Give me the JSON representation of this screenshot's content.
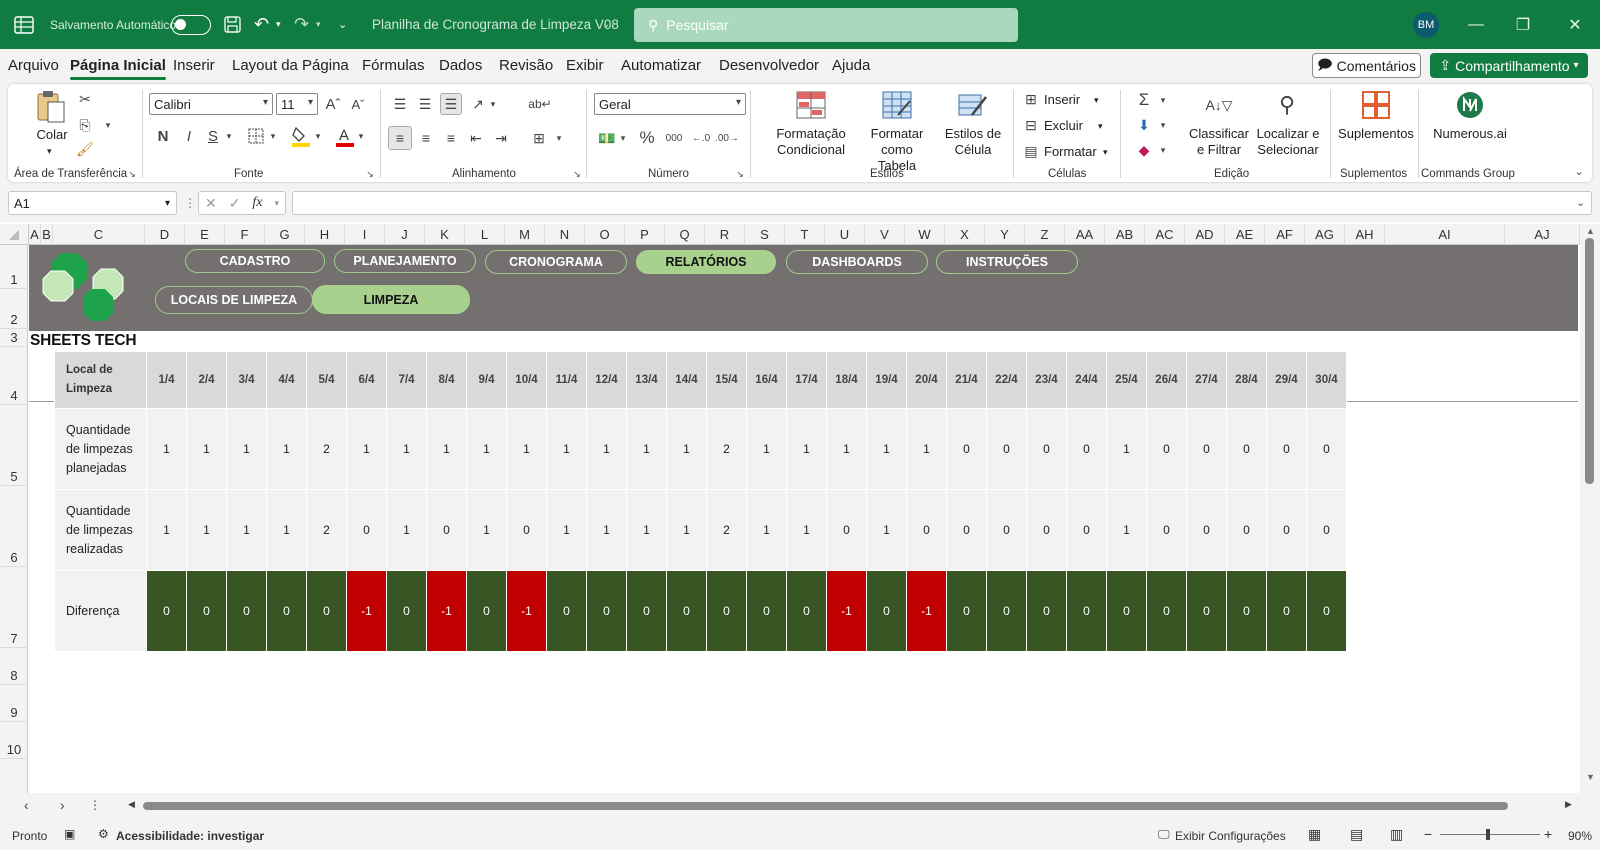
{
  "titlebar": {
    "autosave_label": "Salvamento Automático",
    "doc_title": "Planilha de Cronograma de Limpeza V08",
    "search_placeholder": "Pesquisar",
    "user_initials": "BM"
  },
  "menu": {
    "items": [
      "Arquivo",
      "Página Inicial",
      "Inserir",
      "Layout da Página",
      "Fórmulas",
      "Dados",
      "Revisão",
      "Exibir",
      "Automatizar",
      "Desenvolvedor",
      "Ajuda"
    ],
    "active": "Página Inicial",
    "comments": "Comentários",
    "share": "Compartilhamento"
  },
  "ribbon": {
    "clipboard": {
      "paste": "Colar",
      "group": "Área de Transferência"
    },
    "font": {
      "name": "Calibri",
      "size": "11",
      "group": "Fonte",
      "bold": "N",
      "italic": "I",
      "underline": "S",
      "grow": "A^",
      "shrink": "Aˇ"
    },
    "alignment": {
      "group": "Alinhamento"
    },
    "number": {
      "format": "Geral",
      "group": "Número",
      "percent": "%",
      "thousands": "000"
    },
    "styles": {
      "cond": "Formatação\nCondicional",
      "table": "Formatar como\nTabela",
      "cell": "Estilos de\nCélula",
      "group": "Estilos"
    },
    "cells": {
      "insert": "Inserir",
      "delete": "Excluir",
      "format": "Formatar",
      "group": "Células"
    },
    "editing": {
      "sort": "Classificar\ne Filtrar",
      "find": "Localizar e\nSelecionar",
      "group": "Edição"
    },
    "addins": {
      "label": "Suplementos",
      "group": "Suplementos"
    },
    "commands": {
      "label": "Numerous.ai",
      "group": "Commands Group"
    }
  },
  "formula": {
    "namebox": "A1",
    "value": ""
  },
  "columns": [
    "A",
    "B",
    "C",
    "D",
    "E",
    "F",
    "G",
    "H",
    "I",
    "J",
    "K",
    "L",
    "M",
    "N",
    "O",
    "P",
    "Q",
    "R",
    "S",
    "T",
    "U",
    "V",
    "W",
    "X",
    "Y",
    "Z",
    "AA",
    "AB",
    "AC",
    "AD",
    "AE",
    "AF",
    "AG",
    "AH",
    "AI",
    "AJ"
  ],
  "rows": [
    "1",
    "2",
    "3",
    "4",
    "5",
    "6",
    "7",
    "8",
    "9",
    "10"
  ],
  "banner": {
    "brand": "SHEETS TECH",
    "nav": [
      "CADASTRO",
      "PLANEJAMENTO",
      "CRONOGRAMA",
      "RELATÓRIOS",
      "DASHBOARDS",
      "INSTRUÇÕES",
      "LOCAIS DE LIMPEZA",
      "LIMPEZA"
    ],
    "active_nav": [
      "RELATÓRIOS",
      "LIMPEZA"
    ]
  },
  "report": {
    "header_label": "Local de Limpeza",
    "dates": [
      "1/4",
      "2/4",
      "3/4",
      "4/4",
      "5/4",
      "6/4",
      "7/4",
      "8/4",
      "9/4",
      "10/4",
      "11/4",
      "12/4",
      "13/4",
      "14/4",
      "15/4",
      "16/4",
      "17/4",
      "18/4",
      "19/4",
      "20/4",
      "21/4",
      "22/4",
      "23/4",
      "24/4",
      "25/4",
      "26/4",
      "27/4",
      "28/4",
      "29/4",
      "30/4"
    ],
    "planned_label": "Quantidade de limpezas planejadas",
    "planned": [
      1,
      1,
      1,
      1,
      2,
      1,
      1,
      1,
      1,
      1,
      1,
      1,
      1,
      1,
      2,
      1,
      1,
      1,
      1,
      1,
      0,
      0,
      0,
      0,
      1,
      0,
      0,
      0,
      0,
      0
    ],
    "done_label": "Quantidade de limpezas realizadas",
    "done": [
      1,
      1,
      1,
      1,
      2,
      0,
      1,
      0,
      1,
      0,
      1,
      1,
      1,
      1,
      2,
      1,
      1,
      0,
      1,
      0,
      0,
      0,
      0,
      0,
      1,
      0,
      0,
      0,
      0,
      0
    ],
    "diff_label": "Diferença",
    "diff": [
      0,
      0,
      0,
      0,
      0,
      -1,
      0,
      -1,
      0,
      -1,
      0,
      0,
      0,
      0,
      0,
      0,
      0,
      -1,
      0,
      -1,
      0,
      0,
      0,
      0,
      0,
      0,
      0,
      0,
      0,
      0
    ],
    "colors": {
      "ok": "#375623",
      "negative": "#c00000"
    }
  },
  "status": {
    "ready": "Pronto",
    "accessibility": "Acessibilidade: investigar",
    "display_settings": "Exibir Configurações",
    "zoom": "90%"
  }
}
